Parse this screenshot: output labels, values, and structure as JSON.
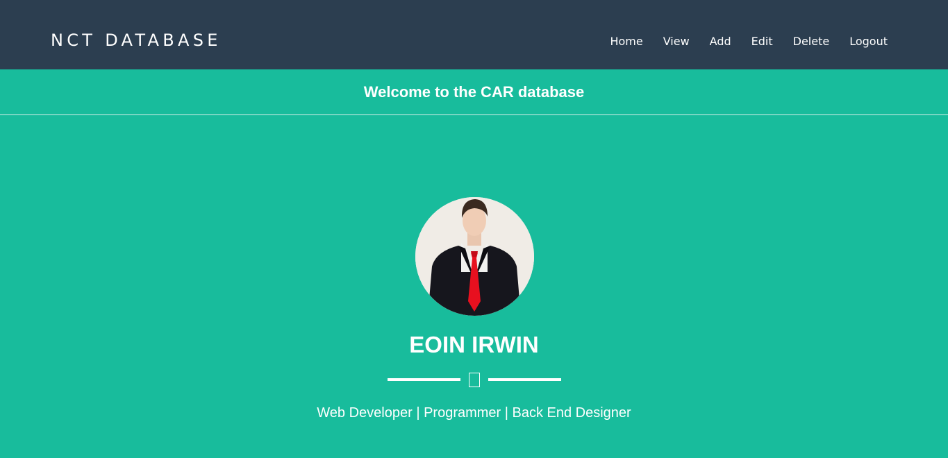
{
  "brand": "NCT DATABASE",
  "nav": {
    "home": "Home",
    "view": "View",
    "add": "Add",
    "edit": "Edit",
    "delete": "Delete",
    "logout": "Logout"
  },
  "welcome_heading": "Welcome to the CAR database",
  "profile": {
    "name": "EOIN IRWIN",
    "tagline": "Web Developer | Programmer | Back End Designer"
  },
  "colors": {
    "navbar": "#2c3e50",
    "background": "#18bc9c",
    "text": "#ffffff",
    "tie": "#e8101f"
  }
}
